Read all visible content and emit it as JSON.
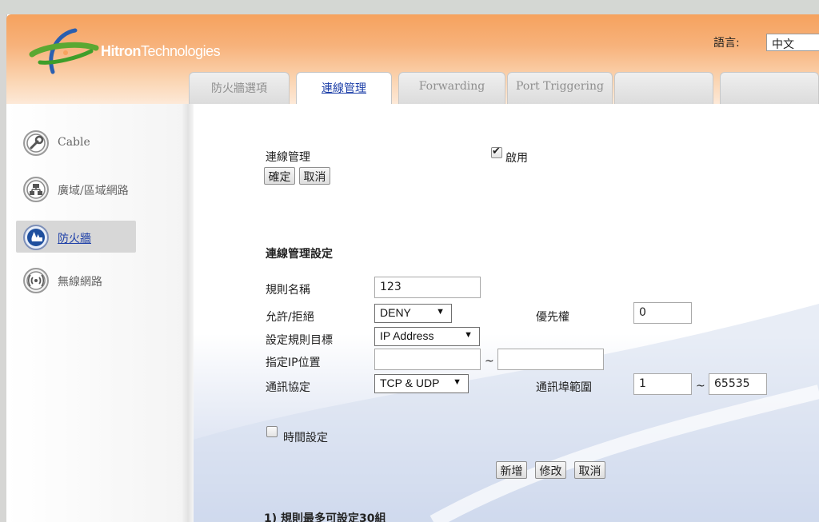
{
  "header": {
    "brand_bold": "Hitron",
    "brand_light": "Technologies",
    "language_label": "語言:",
    "language_value": "中文"
  },
  "tabs": [
    {
      "label": "防火牆選項",
      "active": false
    },
    {
      "label": "連線管理",
      "active": true
    },
    {
      "label": "Forwarding",
      "active": false
    },
    {
      "label": "Port Triggering",
      "active": false
    },
    {
      "label": "",
      "active": false
    }
  ],
  "sidebar": {
    "items": [
      {
        "label": "Cable",
        "icon": "wrench-icon"
      },
      {
        "label": "廣域/區域網路",
        "icon": "network-icon"
      },
      {
        "label": "防火牆",
        "icon": "firewall-icon",
        "active": true
      },
      {
        "label": "無線網路",
        "icon": "wireless-icon"
      }
    ]
  },
  "main": {
    "section1": {
      "title": "連線管理",
      "enable_label": "啟用",
      "enable_checked": true,
      "confirm_button": "確定",
      "cancel_button": "取消"
    },
    "section2": {
      "title": "連線管理設定",
      "rule_name_label": "規則名稱",
      "rule_name_value": "123",
      "allow_deny_label": "允許/拒絕",
      "allow_deny_value": "DENY",
      "priority_label": "優先權",
      "priority_value": "0",
      "target_label": "設定規則目標",
      "target_value": "IP Address",
      "ip_label": "指定IP位置",
      "ip_start_value": "",
      "ip_end_value": "",
      "tilde": "~",
      "protocol_label": "通訊協定",
      "protocol_value": "TCP & UDP",
      "port_range_label": "通訊埠範圍",
      "port_start_value": "1",
      "port_end_value": "65535",
      "time_setting_label": "時間設定",
      "time_setting_checked": false,
      "add_button": "新增",
      "modify_button": "修改",
      "cancel_button": "取消"
    },
    "note": "1) 規則最多可設定30組"
  },
  "colors": {
    "header_orange": "#f6a25e",
    "active_link": "#1d3fa8",
    "logo_green": "#5aa832",
    "logo_blue": "#2a5fb0"
  }
}
